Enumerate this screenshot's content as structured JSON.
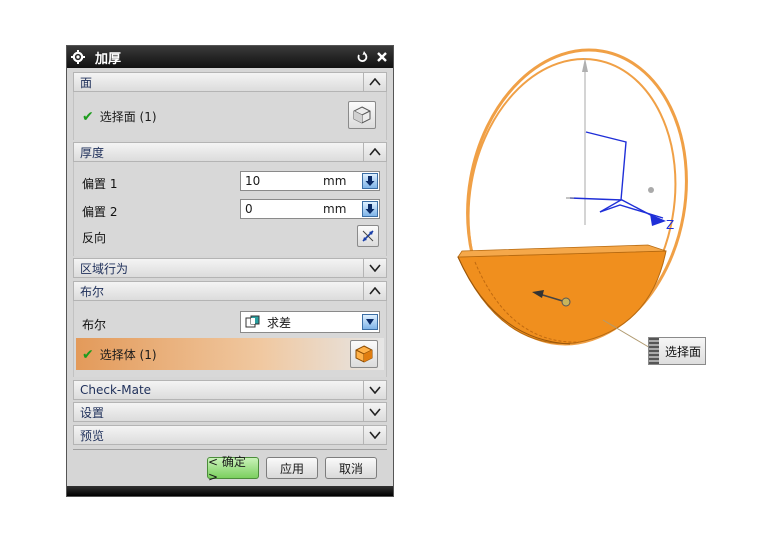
{
  "dialog": {
    "title": "加厚",
    "sections": {
      "face": {
        "label": "面",
        "select_label": "选择面 (1)"
      },
      "thickness": {
        "label": "厚度",
        "offset1_label": "偏置 1",
        "offset1_value": "10",
        "offset1_unit": "mm",
        "offset2_label": "偏置 2",
        "offset2_value": "0",
        "offset2_unit": "mm",
        "reverse_label": "反向"
      },
      "region_behavior": {
        "label": "区域行为"
      },
      "boolean": {
        "label": "布尔",
        "boolean_label": "布尔",
        "boolean_value": "求差",
        "select_label": "选择体 (1)"
      },
      "checkmate": {
        "label": "Check-Mate"
      },
      "settings": {
        "label": "设置"
      },
      "preview": {
        "label": "预览"
      }
    },
    "buttons": {
      "ok": "< 确定 >",
      "apply": "应用",
      "cancel": "取消"
    }
  },
  "viewport": {
    "callout_label": "选择面"
  },
  "colors": {
    "model_orange": "#f08f1e",
    "axis_blue": "#1f2fd8",
    "highlight": "#f0a046"
  }
}
